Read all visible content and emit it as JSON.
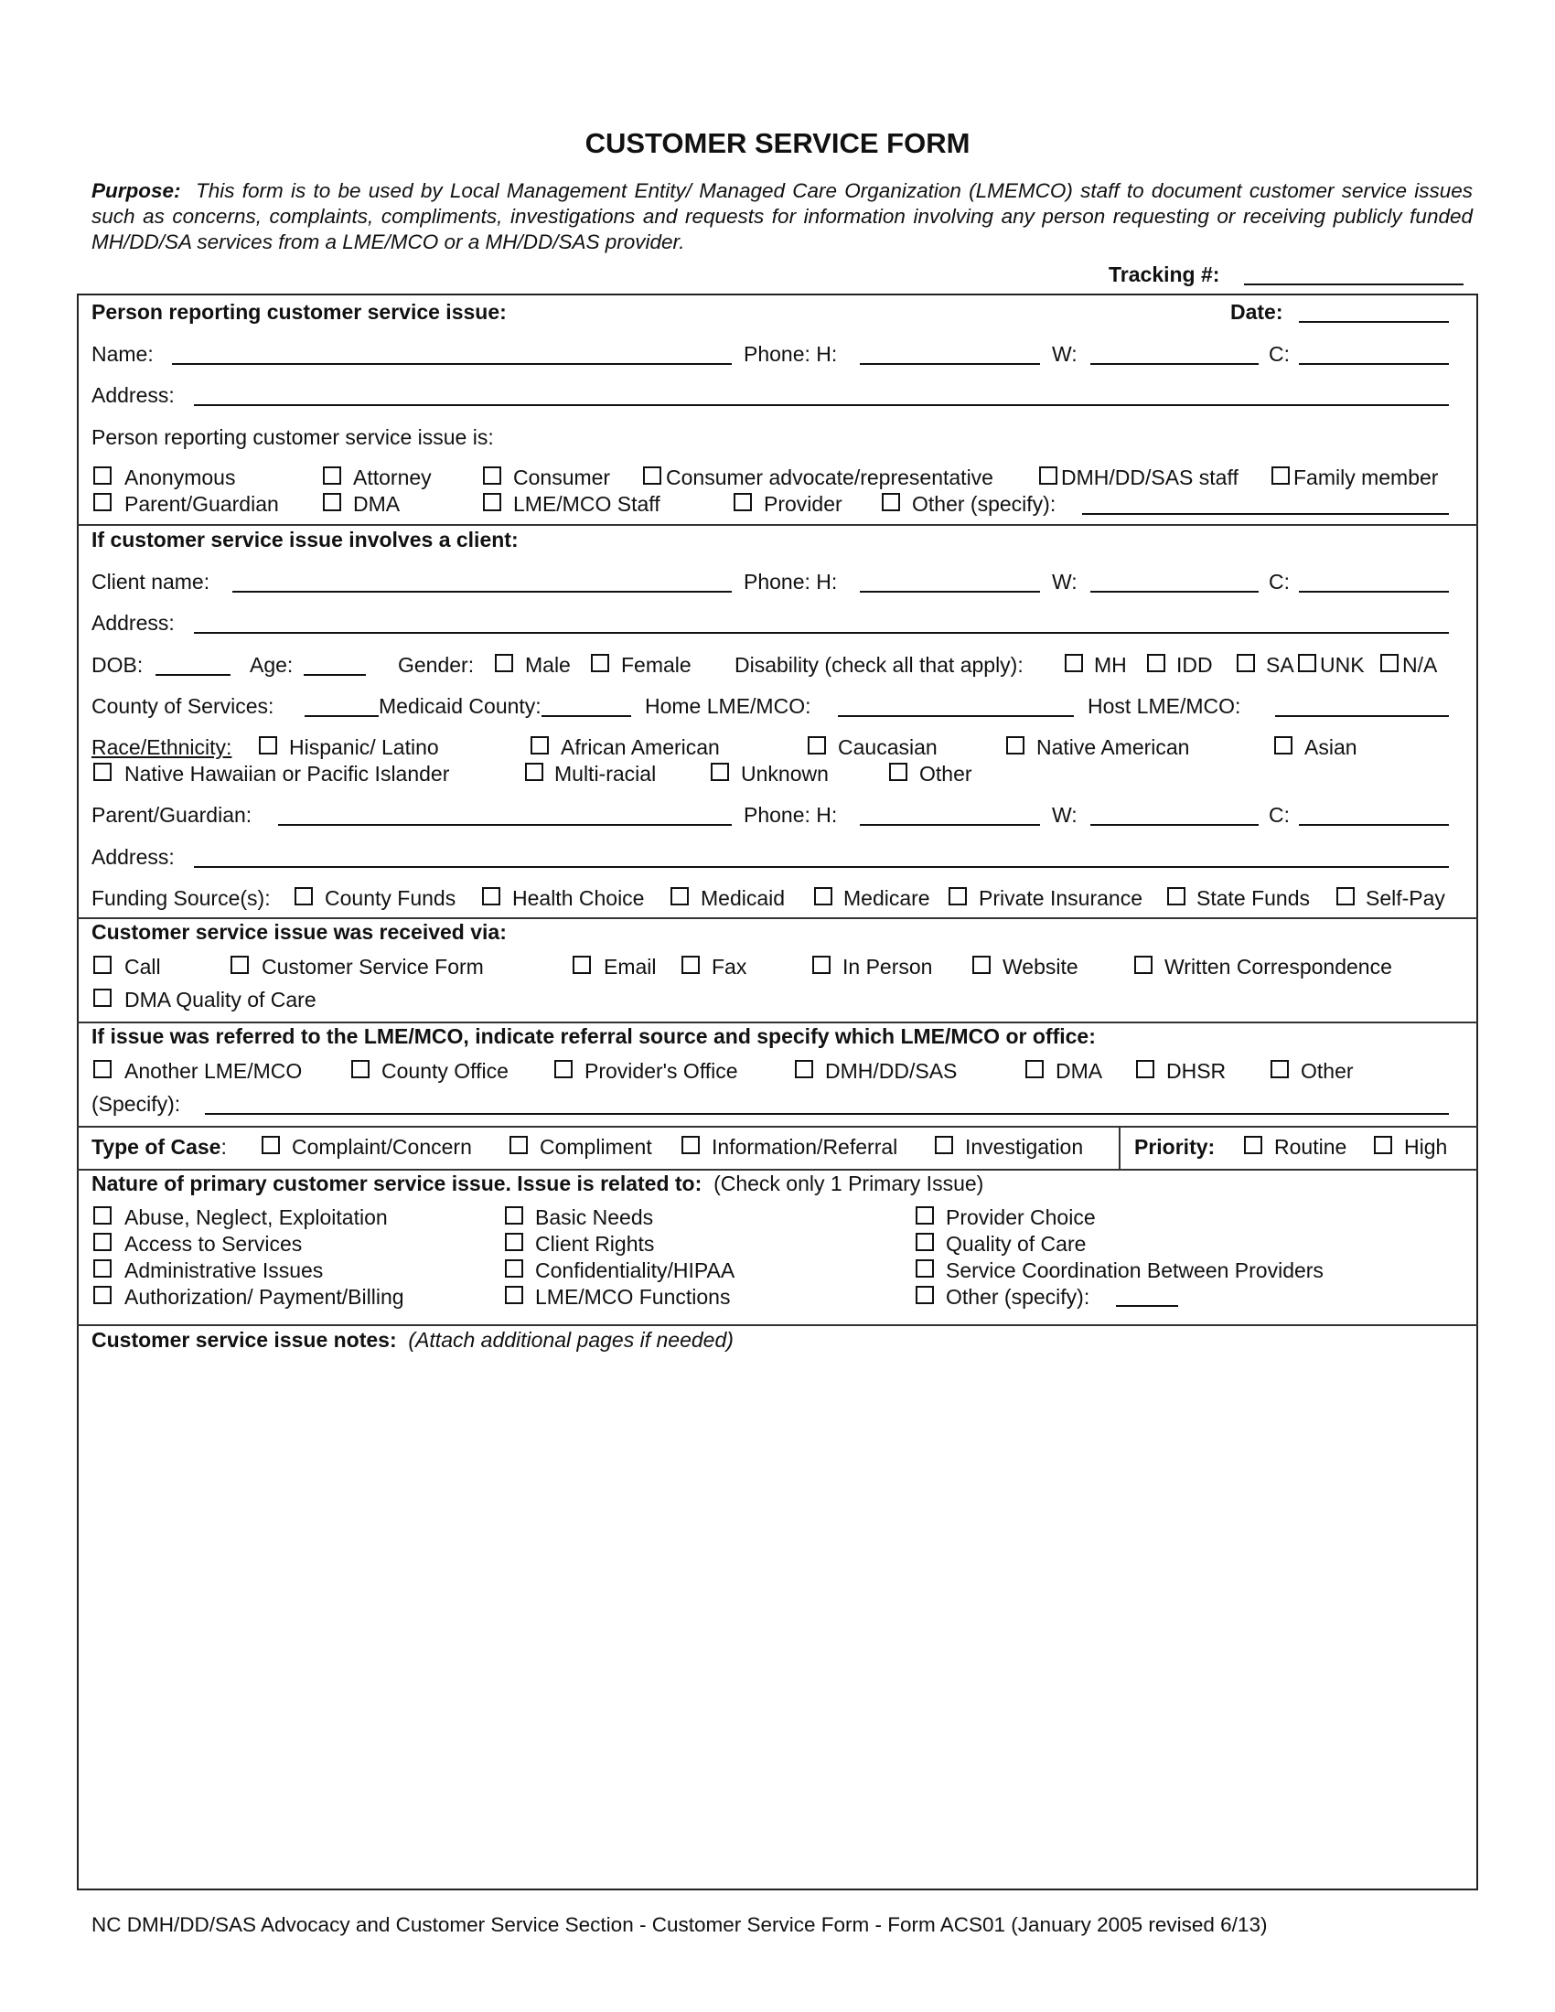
{
  "title": "CUSTOMER SERVICE FORM",
  "purpose": {
    "label": "Purpose:",
    "text": "This form is to be used by Local Management Entity/ Managed Care Organization (LMEMCO) staff to document customer service issues such as concerns, complaints, compliments, investigations and requests for information involving any person requesting or receiving publicly funded MH/DD/SA services from a LME/MCO or a MH/DD/SAS provider."
  },
  "tracking": {
    "label": "Tracking #:",
    "value": ""
  },
  "reporter": {
    "heading": "Person reporting customer service issue:",
    "date_label": "Date:",
    "name_label": "Name:",
    "phone_label": "Phone:  H:",
    "w_label": "W:",
    "c_label": "C:",
    "address_label": "Address:",
    "is_label": "Person reporting customer service issue is:",
    "types": [
      "Anonymous",
      "Attorney",
      "Consumer",
      "Consumer advocate/representative",
      "DMH/DD/SAS staff",
      "Family member",
      "Parent/Guardian",
      "DMA",
      "LME/MCO Staff",
      "Provider",
      "Other (specify):"
    ]
  },
  "client": {
    "heading": "If customer service issue involves a client:",
    "name_label": "Client name:",
    "phone_label": "Phone:  H:",
    "w_label": "W:",
    "c_label": "C:",
    "address_label": "Address:",
    "dob_label": "DOB:",
    "age_label": "Age:",
    "gender_label": "Gender:",
    "genders": [
      "Male",
      "Female"
    ],
    "disability_label": "Disability (check all that apply):",
    "disabilities": [
      "MH",
      "IDD",
      "SA",
      "UNK",
      "N/A"
    ],
    "county_label": "County of Services:",
    "medicaid_county_label": "Medicaid County:",
    "home_lme_label": "Home LME/MCO:",
    "host_lme_label": "Host LME/MCO:",
    "race_label": "Race/Ethnicity:",
    "races": [
      "Hispanic/ Latino",
      "African American",
      "Caucasian",
      "Native American",
      "Asian",
      "Native Hawaiian or Pacific Islander",
      "Multi-racial",
      "Unknown",
      "Other"
    ],
    "guardian_label": "Parent/Guardian:",
    "guardian_phone_label": "Phone:  H:",
    "guardian_w_label": "W:",
    "guardian_c_label": "C:",
    "guardian_address_label": "Address:",
    "funding_label": "Funding Source(s):",
    "funding": [
      "County Funds",
      "Health Choice",
      "Medicaid",
      "Medicare",
      "Private Insurance",
      "State Funds",
      "Self-Pay"
    ]
  },
  "received": {
    "heading": "Customer service issue was received via:",
    "options": [
      "Call",
      "Customer Service Form",
      "Email",
      "Fax",
      "In Person",
      "Website",
      "Written Correspondence",
      "DMA Quality of Care"
    ]
  },
  "referral": {
    "heading": "If issue was referred to the LME/MCO, indicate referral source and specify which LME/MCO or office:",
    "options": [
      "Another LME/MCO",
      "County Office",
      "Provider's Office",
      "DMH/DD/SAS",
      "DMA",
      "DHSR",
      "Other"
    ],
    "specify_label": "(Specify):"
  },
  "case_type": {
    "label": "Type of Case",
    "colon": ":",
    "options": [
      "Complaint/Concern",
      "Compliment",
      "Information/Referral",
      "Investigation"
    ]
  },
  "priority": {
    "label": "Priority:",
    "options": [
      "Routine",
      "High"
    ]
  },
  "nature": {
    "heading": "Nature of primary customer service issue.  Issue is related to:",
    "note": "(Check only 1 Primary Issue)",
    "options": [
      "Abuse, Neglect, Exploitation",
      "Access to Services",
      "Administrative Issues",
      "Authorization/ Payment/Billing",
      "Basic Needs",
      "Client Rights",
      "Confidentiality/HIPAA",
      "LME/MCO Functions",
      "Provider Choice",
      "Quality of Care",
      "Service Coordination  Between Providers",
      "Other (specify):"
    ]
  },
  "notes": {
    "heading": "Customer service issue notes:",
    "note": "(Attach additional pages if needed)"
  },
  "footer": "NC DMH/DD/SAS Advocacy and Customer Service Section - Customer Service Form - Form ACS01 (January 2005 revised 6/13)"
}
